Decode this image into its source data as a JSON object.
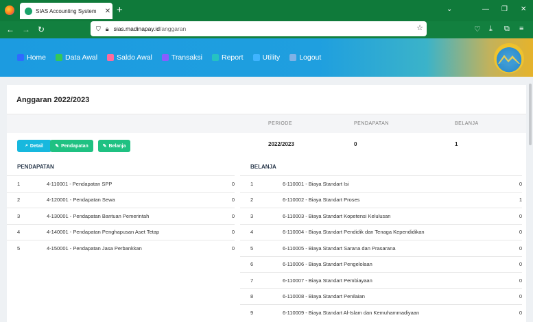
{
  "browser": {
    "tab_title": "SIAS Accounting System",
    "url_host": "sias.madinapay.id",
    "url_path": "/anggaran"
  },
  "menu": [
    {
      "label": "Home",
      "icon": "home-icon",
      "color": "#2f6bff"
    },
    {
      "label": "Data Awal",
      "icon": "monitor-icon",
      "color": "#34c759"
    },
    {
      "label": "Saldo Awal",
      "icon": "edit-icon",
      "color": "#ff6b9d"
    },
    {
      "label": "Transaksi",
      "icon": "table-icon",
      "color": "#8a5cff"
    },
    {
      "label": "Report",
      "icon": "report-icon",
      "color": "#25c2c2"
    },
    {
      "label": "Utility",
      "icon": "tools-icon",
      "color": "#3fb4ff"
    },
    {
      "label": "Logout",
      "icon": "logout-icon",
      "color": "#7fb2e6"
    }
  ],
  "card": {
    "title": "Anggaran 2022/2023",
    "headers": {
      "periode": "PERIODE",
      "pendapatan": "PENDAPATAN",
      "belanja": "BELANJA"
    },
    "values": {
      "periode": "2022/2023",
      "pendapatan": "0",
      "belanja": "1"
    },
    "buttons": {
      "detail": "Detail",
      "pendapatan": "Pendapatan",
      "belanja": "Belanja"
    }
  },
  "pendapatan": {
    "title": "PENDAPATAN",
    "rows": [
      {
        "no": "1",
        "name": "4-110001 - Pendapatan SPP",
        "amount": "0"
      },
      {
        "no": "2",
        "name": "4-120001 - Pendapatan Sewa",
        "amount": "0"
      },
      {
        "no": "3",
        "name": "4-130001 - Pendapatan Bantuan Pemerintah",
        "amount": "0"
      },
      {
        "no": "4",
        "name": "4-140001 - Pendapatan Penghapusan Aset Tetap",
        "amount": "0"
      },
      {
        "no": "5",
        "name": "4-150001 - Pendapatan Jasa Perbankkan",
        "amount": "0"
      }
    ]
  },
  "belanja": {
    "title": "BELANJA",
    "rows": [
      {
        "no": "1",
        "name": "6-110001 - Biaya Standart Isi",
        "amount": "0"
      },
      {
        "no": "2",
        "name": "6-110002 - Biaya Standart Proses",
        "amount": "1"
      },
      {
        "no": "3",
        "name": "6-110003 - Biaya Standart Kopetensi Kelulusan",
        "amount": "0"
      },
      {
        "no": "4",
        "name": "6-110004 - Biaya Standart Pendidik dan Tenaga Kependidikan",
        "amount": "0"
      },
      {
        "no": "5",
        "name": "6-110005 - Biaya Standart Sarana dan Prasarana",
        "amount": "0"
      },
      {
        "no": "6",
        "name": "6-110006 - Biaya Standart Pengelolaan",
        "amount": "0"
      },
      {
        "no": "7",
        "name": "6-110007 - Biaya Standart Pembiayaan",
        "amount": "0"
      },
      {
        "no": "8",
        "name": "6-110008 - Biaya Standart Penilaian",
        "amount": "0"
      },
      {
        "no": "9",
        "name": "6-110009 - Biaya Standart Al-Islam dan Kemuhammadiyaan",
        "amount": "0"
      }
    ]
  }
}
